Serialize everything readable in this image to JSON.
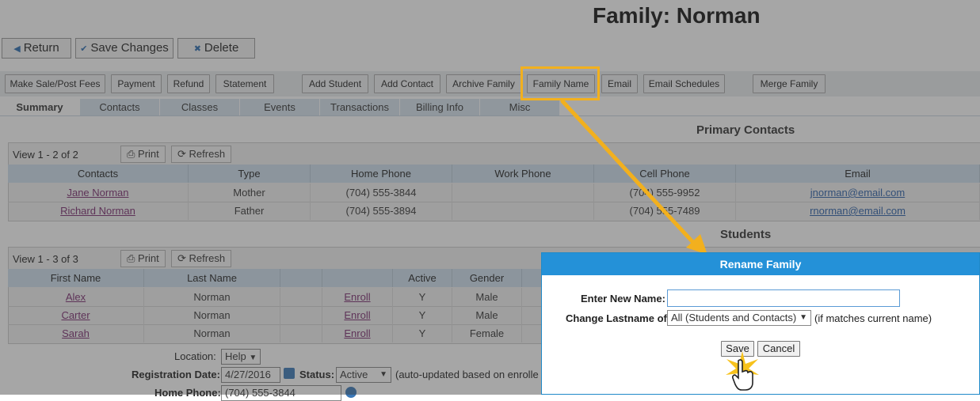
{
  "page": {
    "title": "Family: Norman"
  },
  "top_buttons": {
    "return": "Return",
    "save": "Save Changes",
    "delete": "Delete"
  },
  "actions": {
    "make_sale": "Make Sale/Post Fees",
    "payment": "Payment",
    "refund": "Refund",
    "statement": "Statement",
    "add_student": "Add Student",
    "add_contact": "Add Contact",
    "archive_family": "Archive Family",
    "family_name": "Family Name",
    "email": "Email",
    "email_schedules": "Email Schedules",
    "merge_family": "Merge Family"
  },
  "tabs": [
    "Summary",
    "Contacts",
    "Classes",
    "Events",
    "Transactions",
    "Billing Info",
    "Misc"
  ],
  "primary_contacts": {
    "heading": "Primary Contacts",
    "view_count": "View 1 - 2 of 2",
    "print": "Print",
    "refresh": "Refresh",
    "columns": [
      "Contacts",
      "Type",
      "Home Phone",
      "Work Phone",
      "Cell Phone",
      "Email"
    ],
    "rows": [
      {
        "name": "Jane Norman",
        "type": "Mother",
        "home": "(704) 555-3844",
        "work": "",
        "cell": "(704) 555-9952",
        "email": "jnorman@email.com"
      },
      {
        "name": "Richard Norman",
        "type": "Father",
        "home": "(704) 555-3894",
        "work": "",
        "cell": "(704) 555-7489",
        "email": "rnorman@email.com"
      }
    ]
  },
  "students": {
    "heading": "Students",
    "view_count": "View 1 - 3 of 3",
    "print": "Print",
    "refresh": "Refresh",
    "columns": [
      "First Name",
      "Last Name",
      "",
      "",
      "Active",
      "Gender"
    ],
    "rows": [
      {
        "first": "Alex",
        "last": "Norman",
        "enroll": "Enroll",
        "active": "Y",
        "gender": "Male"
      },
      {
        "first": "Carter",
        "last": "Norman",
        "enroll": "Enroll",
        "active": "Y",
        "gender": "Male"
      },
      {
        "first": "Sarah",
        "last": "Norman",
        "enroll": "Enroll",
        "active": "Y",
        "gender": "Female"
      }
    ]
  },
  "form": {
    "location_label": "Location:",
    "location_value": "Help",
    "reg_date_label": "Registration Date:",
    "reg_date_value": "4/27/2016",
    "status_label": "Status:",
    "status_value": "Active",
    "status_note": "(auto-updated based on enrolle",
    "home_phone_label": "Home Phone:",
    "home_phone_value": "(704) 555-3844"
  },
  "dialog": {
    "title": "Rename Family",
    "new_name_label": "Enter New Name:",
    "new_name_value": "",
    "change_lastname_label": "Change Lastname of:",
    "change_lastname_value": "All (Students and Contacts)",
    "match_note": "(if matches current name)",
    "save": "Save",
    "cancel": "Cancel"
  },
  "colors": {
    "accent": "#2491d8",
    "highlight": "#f2b01e",
    "header_bg": "#cfe0ee",
    "tab_bg": "#d7e4ef"
  }
}
